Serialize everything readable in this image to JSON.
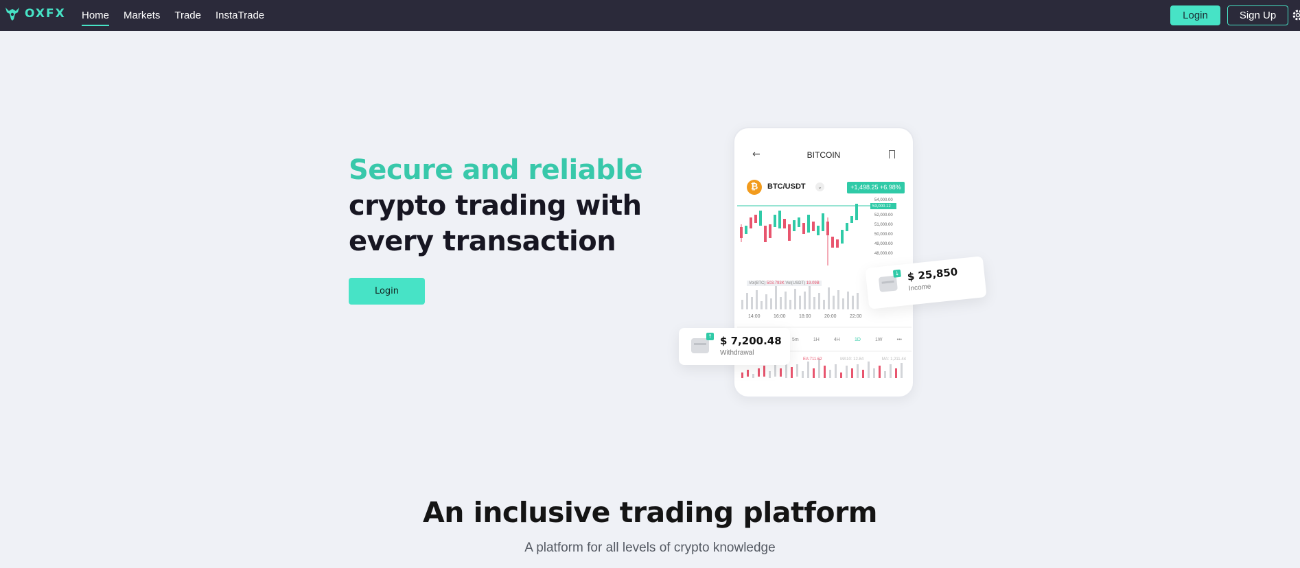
{
  "brand": {
    "name": "OXFX",
    "accent_color": "#47e3c6"
  },
  "nav": {
    "links": [
      {
        "label": "Home",
        "active": true
      },
      {
        "label": "Markets",
        "active": false
      },
      {
        "label": "Trade",
        "active": false
      },
      {
        "label": "InstaTrade",
        "active": false
      }
    ],
    "login_label": "Login",
    "signup_label": "Sign Up",
    "settings_icon": "gear-icon"
  },
  "hero": {
    "title_accent": "Secure and reliable",
    "title_line2": "crypto trading with",
    "title_line3": "every transaction",
    "login_label": "Login",
    "accent_color": "#38c8aa"
  },
  "phone": {
    "title": "BITCOIN",
    "pair": "BTC/USDT",
    "change": "+1,498.25  +6.98%",
    "price_labels": [
      "54,000.00",
      "53,000.12",
      "52,000.00",
      "51,000.00",
      "50,000.00",
      "49,000.00",
      "48,000.00"
    ],
    "time_labels": [
      "14:00",
      "16:00",
      "18:00",
      "20:00",
      "22:00"
    ],
    "volume_row": {
      "base": "Vol(BTC)",
      "base_value": "503.793K",
      "quote": "Vol(USDT)",
      "quote_value": "19.09B"
    },
    "intervals": [
      "5m",
      "1H",
      "4H",
      "1D",
      "1W",
      "•••"
    ],
    "active_interval": "1D",
    "lower_values": [
      "EA:711.62",
      "MA10: 12.84",
      "MA: 1,211.44"
    ]
  },
  "cards": {
    "income": {
      "amount": "$ 25,850",
      "label": "Income"
    },
    "withdrawal": {
      "amount": "$ 7,200.48",
      "label": "Withdrawal"
    }
  },
  "section": {
    "title": "An inclusive trading platform",
    "subtitle": "A platform for all levels of crypto knowledge"
  }
}
